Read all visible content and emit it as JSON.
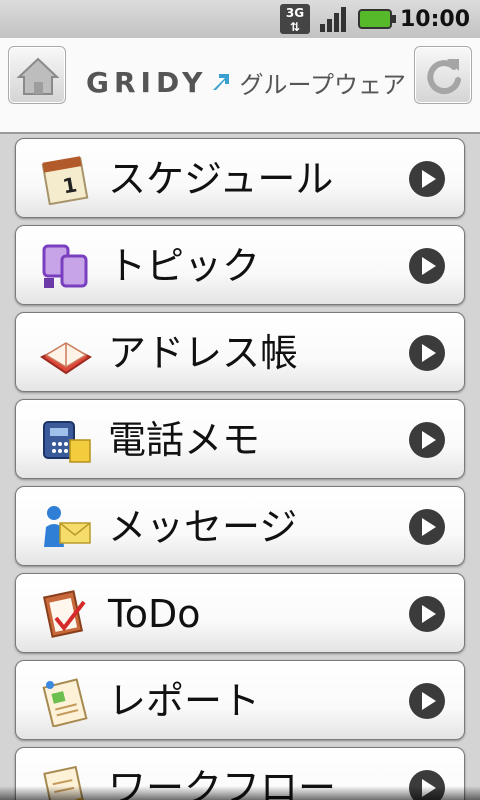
{
  "statusbar": {
    "network_label": "3G",
    "time": "10:00"
  },
  "header": {
    "logo_brand": "GRIDY",
    "logo_suffix": "グループウェア"
  },
  "menu": {
    "items": [
      {
        "label": "スケジュール",
        "icon": "calendar-icon"
      },
      {
        "label": "トピック",
        "icon": "topic-icon"
      },
      {
        "label": "アドレス帳",
        "icon": "address-book-icon"
      },
      {
        "label": "電話メモ",
        "icon": "phone-memo-icon"
      },
      {
        "label": "メッセージ",
        "icon": "message-icon"
      },
      {
        "label": "ToDo",
        "icon": "todo-icon"
      },
      {
        "label": "レポート",
        "icon": "report-icon"
      },
      {
        "label": "ワークフロー",
        "icon": "workflow-icon"
      }
    ]
  },
  "colors": {
    "status_bg": "#cfcfcf",
    "header_bg": "#fafafa",
    "list_bg": "#d4d4d4",
    "battery_green": "#55b92a",
    "arrow_dark": "#3b3b3b"
  }
}
